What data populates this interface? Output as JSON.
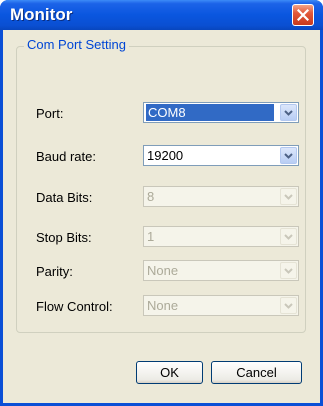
{
  "window": {
    "title": "Monitor"
  },
  "group": {
    "legend": "Com Port Setting"
  },
  "fields": [
    {
      "label": "Port:",
      "value": "COM8",
      "enabled": true,
      "selected": true
    },
    {
      "label": "Baud rate:",
      "value": "19200",
      "enabled": true,
      "selected": false
    },
    {
      "label": "Data Bits:",
      "value": "8",
      "enabled": false
    },
    {
      "label": "Stop Bits:",
      "value": "1",
      "enabled": false
    },
    {
      "label": "Parity:",
      "value": "None",
      "enabled": false
    },
    {
      "label": "Flow Control:",
      "value": "None",
      "enabled": false
    }
  ],
  "buttons": {
    "ok": "OK",
    "cancel": "Cancel"
  },
  "icons": {
    "close": "close-icon",
    "dropdown": "chevron-down-icon"
  }
}
